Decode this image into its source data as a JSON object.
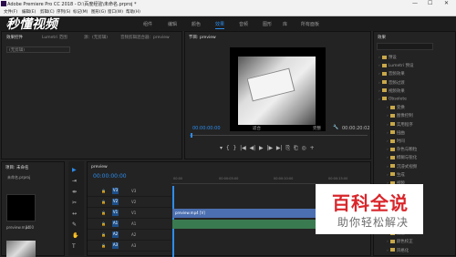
{
  "titlebar": {
    "title": "Adobe Premiere Pro CC 2018 - D:\\百度经验\\未命名.prproj *",
    "min": "—",
    "max": "☐",
    "close": "✕"
  },
  "menu": [
    "文件(F)",
    "编辑(E)",
    "剪辑(C)",
    "序列(S)",
    "标记(M)",
    "图形(G)",
    "窗口(W)",
    "帮助(H)"
  ],
  "workspaces": [
    "组件",
    "编辑",
    "颜色",
    "效果",
    "音频",
    "图形",
    "库",
    "所有面板"
  ],
  "active_workspace": "效果",
  "watermark_logo": "秒懂视频",
  "source_panel": {
    "tabs": [
      "效果控件",
      "Lumetri 范围",
      "源：(无剪辑)",
      "音频剪辑混合器：preview"
    ],
    "dropdown": "(无剪辑)"
  },
  "program_panel": {
    "title": "节目: preview",
    "timecode": "00:00:00:00",
    "fit": "适合",
    "quality": "完整",
    "duration": "00:00:20:02"
  },
  "effects_panel": {
    "title": "效果",
    "items": [
      "预设",
      "Lumetri 预设",
      "音频效果",
      "音频过渡",
      "视频效果",
      "Obsolete",
      "变换",
      "图像控制",
      "实用程序",
      "扭曲",
      "时间",
      "杂色与颗粒",
      "模糊与锐化",
      "沉浸式视频",
      "生成",
      "视频",
      "调整",
      "过时",
      "过渡",
      "透视",
      "通道",
      "键控",
      "颜色校正",
      "风格化"
    ]
  },
  "project_panel": {
    "title": "项目: 未命名",
    "file": "未命名.prproj",
    "clip1": "preview.mp4",
    "clip1_len": "1:00"
  },
  "timeline": {
    "title": "preview",
    "timecode": "00:00:00:00",
    "ruler": [
      "00:00",
      "00:00:05:00",
      "00:00:10:00",
      "00:00:15:00"
    ],
    "tracks": [
      {
        "name": "V3",
        "sel": "V3"
      },
      {
        "name": "V2",
        "sel": "V2"
      },
      {
        "name": "V1",
        "sel": "V1"
      },
      {
        "name": "A1",
        "sel": "A1"
      },
      {
        "name": "A2",
        "sel": "A2"
      },
      {
        "name": "A3",
        "sel": "A3"
      }
    ],
    "clip_label": "preview.mp4 [V]"
  },
  "watermark": {
    "big": "百科全说",
    "small": "助你轻松解决"
  },
  "colors": {
    "accent": "#2d8ceb",
    "video_clip": "#4b6fb0",
    "audio_clip": "#3a7a50",
    "watermark_red": "#d9262b"
  }
}
